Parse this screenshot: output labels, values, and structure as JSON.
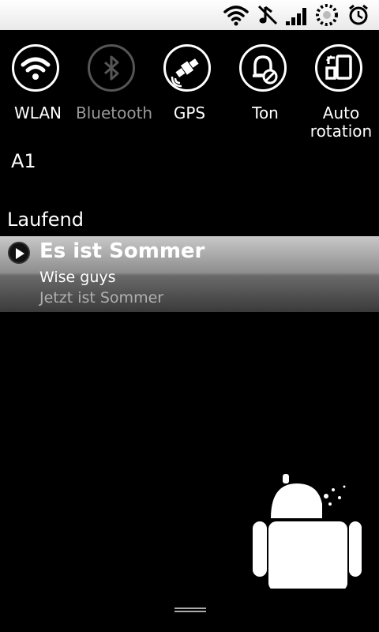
{
  "status_bar": {
    "icons": [
      "wifi-icon",
      "sound-off-icon",
      "signal-icon",
      "loading-icon",
      "alarm-icon"
    ]
  },
  "toggles": [
    {
      "label": "WLAN",
      "icon": "wifi-icon",
      "state": "on"
    },
    {
      "label": "Bluetooth",
      "icon": "bluetooth-icon",
      "state": "off"
    },
    {
      "label": "GPS",
      "icon": "gps-icon",
      "state": "on"
    },
    {
      "label": "Ton",
      "icon": "sound-icon",
      "state": "on"
    },
    {
      "label": "Auto\nrotation",
      "icon": "rotation-icon",
      "state": "on"
    }
  ],
  "operator": "A1",
  "section_title": "Laufend",
  "notification": {
    "title": "Es ist Sommer",
    "artist": "Wise guys",
    "album": "Jetzt ist Sommer"
  },
  "colors": {
    "accent": "#ffffff",
    "inactive": "#555555",
    "background": "#000000"
  }
}
